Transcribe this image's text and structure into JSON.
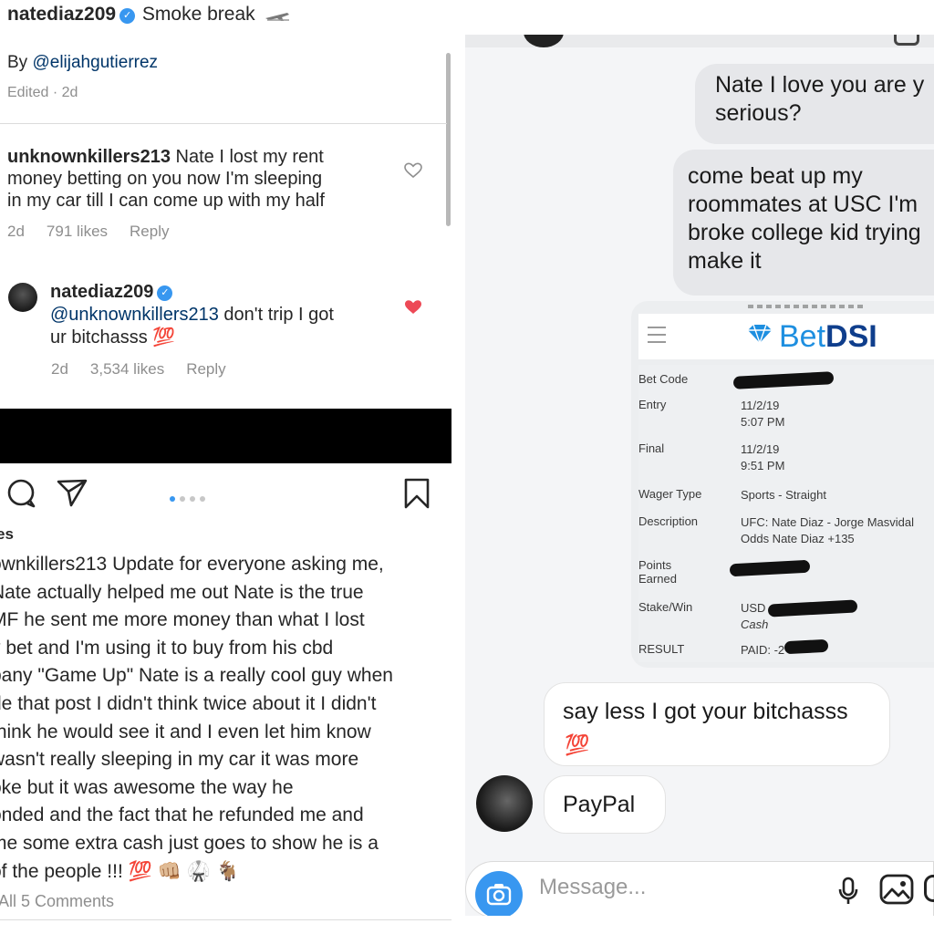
{
  "left": {
    "post_header": {
      "username": "natediaz209",
      "title": "Smoke break"
    },
    "by_line": {
      "prefix": "By",
      "handle": "@elijahgutierrez"
    },
    "edited": "Edited · 2d",
    "comment": {
      "username": "unknownkillers213",
      "lines": [
        " Nate I lost my rent",
        "money betting on you now I'm sleeping",
        "in my car till I can come up with my half"
      ],
      "time": "2d",
      "likes": "791 likes",
      "reply_label": "Reply"
    },
    "reply": {
      "username": "natediaz209",
      "mention": "@unknownkillers213",
      "text_1": " don't trip I got",
      "text_2": "ur bitchasss 💯",
      "time": "2d",
      "likes": "3,534 likes",
      "reply_label": "Reply"
    },
    "likes_cut": "es",
    "update_lines": [
      "ownkillers213 Update for everyone asking me,",
      "Nate actually helped me out Nate is the true",
      "MF he sent me more money than what I lost",
      "y bet  and I'm using it to buy from his cbd",
      "pany \"Game Up\" Nate is a really cool guy when",
      "de that post I didn't think twice about it I didn't",
      " think he would see it and I even let him know",
      " wasn't really sleeping in my car it was more",
      "oke but it was awesome the way he",
      "onded and the fact that he refunded me and",
      " me some extra cash just goes to show he is a",
      " of the people !!! 💯 👊🏼 🥋 🐐"
    ],
    "view_all": "All 5 Comments"
  },
  "right": {
    "bubble_1": [
      "Nate I love you are y",
      "serious?"
    ],
    "bubble_2": [
      "come beat up my",
      "roommates at USC I'm",
      "broke college kid trying",
      "make it"
    ],
    "receipt": {
      "brand_bet": "Bet",
      "brand_dsi": "DSI",
      "rows": {
        "bet_code": "Bet Code",
        "entry": "Entry",
        "entry_date": "11/2/19",
        "entry_time": "5:07 PM",
        "final": "Final",
        "final_date": "11/2/19",
        "final_time": "9:51 PM",
        "wager_type": "Wager Type",
        "wager_type_val": "Sports - Straight",
        "description": "Description",
        "description_val_1": "UFC: Nate Diaz - Jorge Masvidal",
        "description_val_2": "Odds Nate Diaz +135",
        "points": "Points",
        "points_2": "Earned",
        "stake_win": "Stake/Win",
        "stake_val_1": "USD",
        "stake_val_2": "Cash",
        "result": "RESULT",
        "result_val": "PAID: -2"
      }
    },
    "bubble_3": "say less I got your bitchasss",
    "bubble_3_emoji": "💯",
    "bubble_4": "PayPal",
    "composer_placeholder": "Message..."
  },
  "colors": {
    "link": "#003569",
    "verified": "#3897f0",
    "like_red": "#ed4956",
    "camera_blue": "#3897f0",
    "brand_blue": "#1e8fe0",
    "brand_navy": "#0f3e8c"
  }
}
